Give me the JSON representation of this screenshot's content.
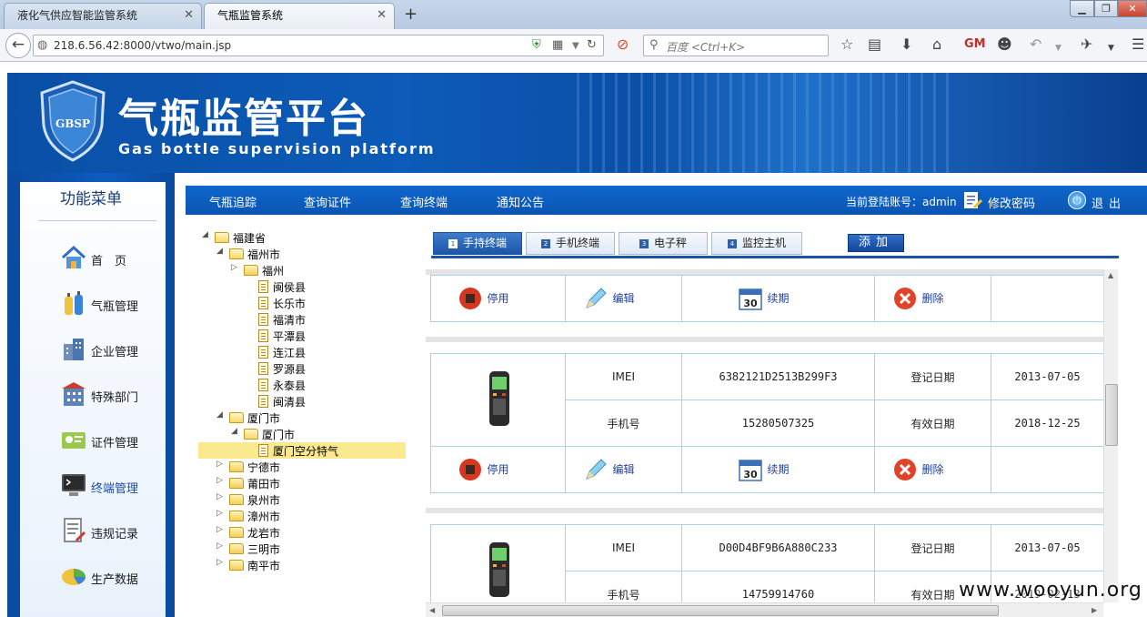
{
  "browser": {
    "tabs": [
      {
        "title": "液化气供应智能监管系统"
      },
      {
        "title": "气瓶监管系统"
      }
    ],
    "url": "218.6.56.42:8000/vtwo/main.jsp",
    "search_placeholder": "百度 <Ctrl+K>"
  },
  "header": {
    "title": "气瓶监管平台",
    "subtitle": "Gas bottle supervision platform",
    "logo_text": "GBSP"
  },
  "sidebar": {
    "title": "功能菜单",
    "items": [
      {
        "label": "首　页",
        "icon": "home-icon"
      },
      {
        "label": "气瓶管理",
        "icon": "gas-bottle-icon"
      },
      {
        "label": "企业管理",
        "icon": "building-icon"
      },
      {
        "label": "特殊部门",
        "icon": "department-icon"
      },
      {
        "label": "证件管理",
        "icon": "certificate-icon"
      },
      {
        "label": "终端管理",
        "icon": "terminal-icon",
        "active": true
      },
      {
        "label": "违规记录",
        "icon": "violation-record-icon"
      },
      {
        "label": "生产数据",
        "icon": "production-data-icon"
      }
    ]
  },
  "topnav": {
    "links": [
      "气瓶追踪",
      "查询证件",
      "查询终端",
      "通知公告"
    ],
    "account_label": "当前登陆账号：admin",
    "change_password": "修改密码",
    "logout": "退出"
  },
  "tree": [
    {
      "label": "福建省",
      "level": 0,
      "type": "folder",
      "expanded": true
    },
    {
      "label": "福州市",
      "level": 1,
      "type": "folder",
      "expanded": true
    },
    {
      "label": "福州",
      "level": 2,
      "type": "folder",
      "expanded": false
    },
    {
      "label": "闽侯县",
      "level": 2,
      "type": "doc"
    },
    {
      "label": "长乐市",
      "level": 2,
      "type": "doc"
    },
    {
      "label": "福清市",
      "level": 2,
      "type": "doc"
    },
    {
      "label": "平潭县",
      "level": 2,
      "type": "doc"
    },
    {
      "label": "连江县",
      "level": 2,
      "type": "doc"
    },
    {
      "label": "罗源县",
      "level": 2,
      "type": "doc"
    },
    {
      "label": "永泰县",
      "level": 2,
      "type": "doc"
    },
    {
      "label": "闽清县",
      "level": 2,
      "type": "doc"
    },
    {
      "label": "厦门市",
      "level": 1,
      "type": "folder",
      "expanded": true
    },
    {
      "label": "厦门市",
      "level": 2,
      "type": "folder",
      "expanded": true
    },
    {
      "label": "厦门空分特气",
      "level": 3,
      "type": "doc",
      "selected": true
    },
    {
      "label": "宁德市",
      "level": 1,
      "type": "folder",
      "expanded": false
    },
    {
      "label": "莆田市",
      "level": 1,
      "type": "folder",
      "expanded": false
    },
    {
      "label": "泉州市",
      "level": 1,
      "type": "folder",
      "expanded": false
    },
    {
      "label": "漳州市",
      "level": 1,
      "type": "folder",
      "expanded": false
    },
    {
      "label": "龙岩市",
      "level": 1,
      "type": "folder",
      "expanded": false
    },
    {
      "label": "三明市",
      "level": 1,
      "type": "folder",
      "expanded": false
    },
    {
      "label": "南平市",
      "level": 1,
      "type": "folder",
      "expanded": false
    }
  ],
  "tabs": [
    {
      "num": "1",
      "label": "手持终端",
      "active": true
    },
    {
      "num": "2",
      "label": "手机终端"
    },
    {
      "num": "3",
      "label": "电子秤"
    },
    {
      "num": "4",
      "label": "监控主机"
    }
  ],
  "add_button": "添加",
  "actions": {
    "stop": "停用",
    "edit": "编辑",
    "renew": "续期",
    "delete": "删除",
    "calendar_day": "30"
  },
  "devices": [
    {
      "imei_label": "IMEI",
      "imei": "6382121D2513B299F3",
      "reg_label": "登记日期",
      "reg_date": "2013-07-05",
      "phone_label": "手机号",
      "phone": "15280507325",
      "valid_label": "有效日期",
      "valid_date": "2018-12-25"
    },
    {
      "imei_label": "IMEI",
      "imei": "D00D4BF9B6A880C233",
      "reg_label": "登记日期",
      "reg_date": "2013-07-05",
      "phone_label": "手机号",
      "phone": "14759914760",
      "valid_label": "有效日期",
      "valid_date": "2019-02-13"
    }
  ],
  "watermark": "www.wooyun.org"
}
